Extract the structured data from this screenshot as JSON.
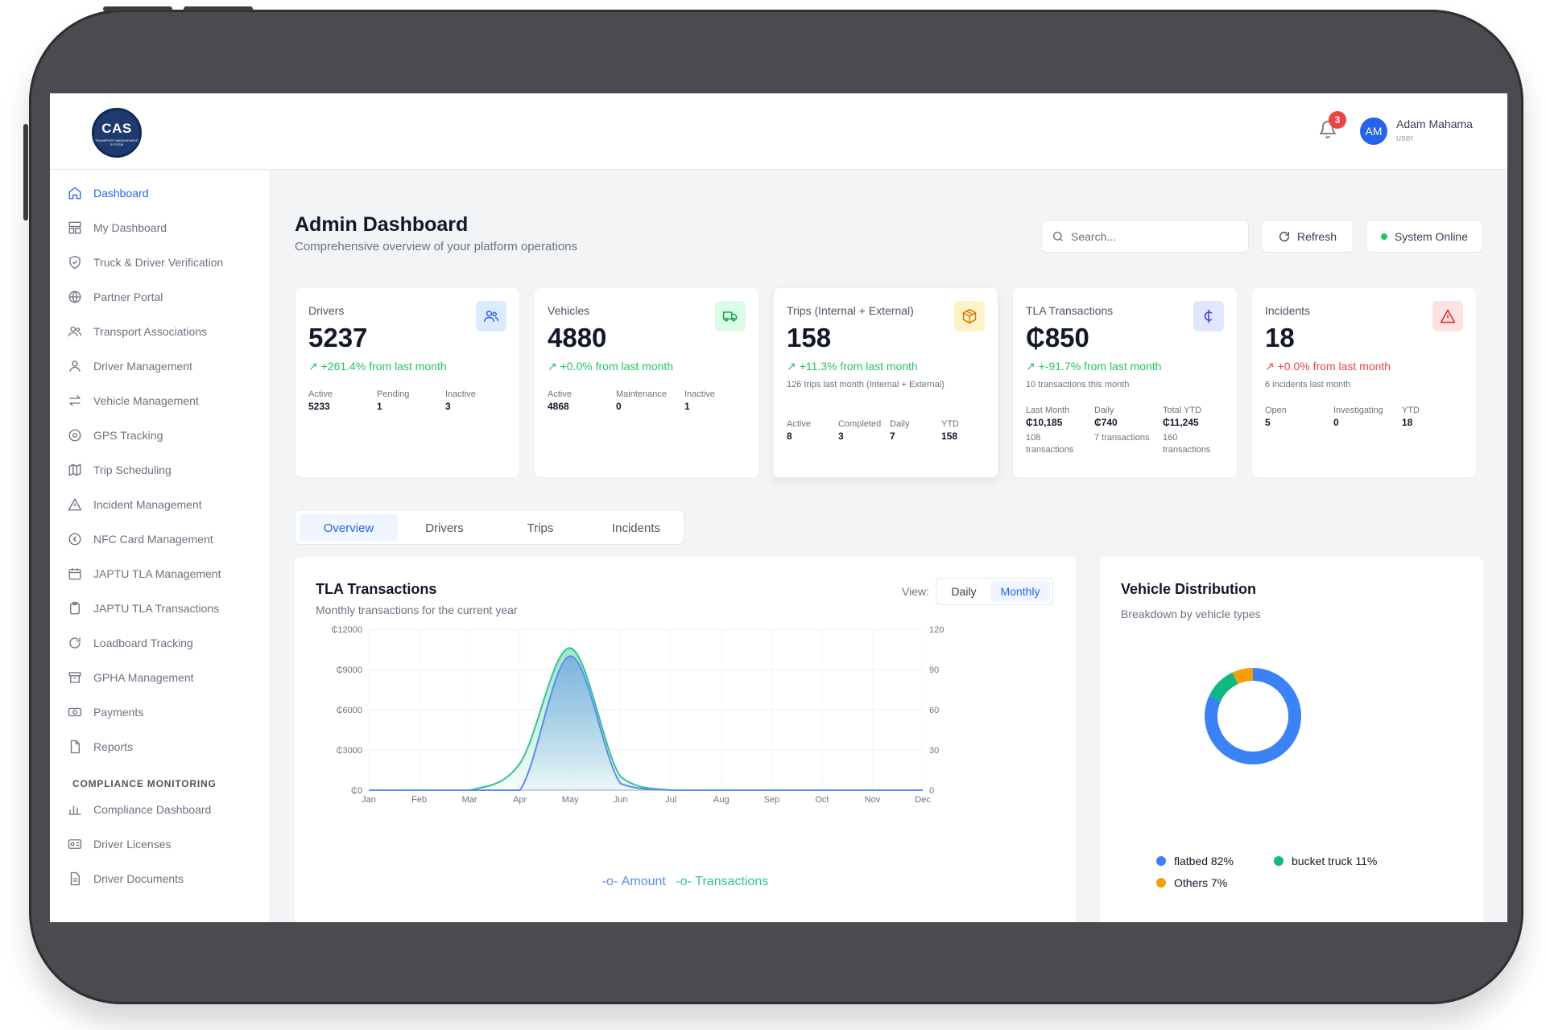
{
  "app": {
    "logo_text": "CAS",
    "logo_subtitle": "Transport Management System"
  },
  "topbar": {
    "notification_count": "3",
    "user_initials": "AM",
    "user_name": "Adam Mahama",
    "user_role": "user"
  },
  "sidebar": {
    "items": [
      {
        "label": "Dashboard",
        "icon": "home-icon"
      },
      {
        "label": "My Dashboard",
        "icon": "layout-icon"
      },
      {
        "label": "Truck & Driver Verification",
        "icon": "shield-check-icon"
      },
      {
        "label": "Partner Portal",
        "icon": "globe-icon"
      },
      {
        "label": "Transport Associations",
        "icon": "users-icon"
      },
      {
        "label": "Driver Management",
        "icon": "user-icon"
      },
      {
        "label": "Vehicle Management",
        "icon": "arrows-icon"
      },
      {
        "label": "GPS Tracking",
        "icon": "map-pin-icon"
      },
      {
        "label": "Trip Scheduling",
        "icon": "map-icon"
      },
      {
        "label": "Incident Management",
        "icon": "alert-triangle-icon"
      },
      {
        "label": "NFC Card Management",
        "icon": "coin-icon"
      },
      {
        "label": "JAPTU TLA Management",
        "icon": "calendar-icon"
      },
      {
        "label": "JAPTU TLA Transactions",
        "icon": "clipboard-icon"
      },
      {
        "label": "Loadboard Tracking",
        "icon": "refresh-icon"
      },
      {
        "label": "GPHA Management",
        "icon": "archive-icon"
      },
      {
        "label": "Payments",
        "icon": "banknote-icon"
      },
      {
        "label": "Reports",
        "icon": "file-icon"
      }
    ],
    "section_title": "COMPLIANCE MONITORING",
    "compliance_items": [
      {
        "label": "Compliance Dashboard",
        "icon": "bar-chart-icon"
      },
      {
        "label": "Driver Licenses",
        "icon": "id-card-icon"
      },
      {
        "label": "Driver Documents",
        "icon": "document-icon"
      }
    ]
  },
  "header": {
    "title": "Admin Dashboard",
    "subtitle": "Comprehensive overview of your platform operations",
    "search_placeholder": "Search...",
    "refresh_label": "Refresh",
    "status_label": "System Online"
  },
  "cards": {
    "drivers": {
      "title": "Drivers",
      "value": "5237",
      "change": "+261.4% from last month",
      "stats": [
        {
          "label": "Active",
          "value": "5233"
        },
        {
          "label": "Pending",
          "value": "1"
        },
        {
          "label": "Inactive",
          "value": "3"
        }
      ]
    },
    "vehicles": {
      "title": "Vehicles",
      "value": "4880",
      "change": "+0.0% from last month",
      "stats": [
        {
          "label": "Active",
          "value": "4868"
        },
        {
          "label": "Maintenance",
          "value": "0"
        },
        {
          "label": "Inactive",
          "value": "1"
        }
      ]
    },
    "trips": {
      "title": "Trips (Internal + External)",
      "value": "158",
      "change": "+11.3% from last month",
      "note": "126 trips last month (Internal + External)",
      "stats": [
        {
          "label": "Active",
          "value": "8"
        },
        {
          "label": "Completed",
          "value": "3"
        },
        {
          "label": "Daily",
          "value": "7"
        },
        {
          "label": "YTD",
          "value": "158"
        }
      ]
    },
    "tla": {
      "title": "TLA Transactions",
      "value": "₵850",
      "change": "+-91.7% from last month",
      "note": "10 transactions this month",
      "stats": [
        {
          "label": "Last Month",
          "value": "₵10,185",
          "sub": "108 transactions"
        },
        {
          "label": "Daily",
          "value": "₵740",
          "sub": "7 transactions"
        },
        {
          "label": "Total YTD",
          "value": "₵11,245",
          "sub": "160 transactions"
        }
      ]
    },
    "incidents": {
      "title": "Incidents",
      "value": "18",
      "change": "+0.0% from last month",
      "note": "6 incidents last month",
      "stats": [
        {
          "label": "Open",
          "value": "5"
        },
        {
          "label": "Investigating",
          "value": "0"
        },
        {
          "label": "YTD",
          "value": "18"
        }
      ]
    }
  },
  "colors": {
    "primary": "#2563eb",
    "positive": "#22c55e",
    "negative": "#ef4444",
    "amount_line": "#5b8def",
    "transactions_line": "#34c38f",
    "flatbed": "#3b82f6",
    "bucket_truck": "#10b981",
    "others": "#f59e0b"
  },
  "tabs": [
    "Overview",
    "Drivers",
    "Trips",
    "Incidents"
  ],
  "tla_chart": {
    "title": "TLA Transactions",
    "subtitle": "Monthly transactions for the current year",
    "view_label": "View:",
    "view_options": [
      "Daily",
      "Monthly"
    ],
    "selected_view": "Monthly"
  },
  "vehicle_distribution": {
    "title": "Vehicle Distribution",
    "subtitle": "Breakdown by vehicle types"
  },
  "chart_data": [
    {
      "type": "area",
      "x": [
        "Jan",
        "Feb",
        "Mar",
        "Apr",
        "May",
        "Jun",
        "Jul",
        "Aug",
        "Sep",
        "Oct",
        "Nov",
        "Dec"
      ],
      "series": [
        {
          "name": "Amount",
          "axis": "left",
          "values": [
            0,
            0,
            0,
            0,
            10000,
            500,
            0,
            0,
            0,
            0,
            0,
            0
          ]
        },
        {
          "name": "Transactions",
          "axis": "right",
          "values": [
            0,
            0,
            0,
            20,
            106,
            10,
            0,
            0,
            0,
            0,
            0,
            0
          ]
        }
      ],
      "y_left_ticks": [
        "₵0",
        "₵3000",
        "₵6000",
        "₵9000",
        "₵12000"
      ],
      "y_right_ticks": [
        "0",
        "30",
        "60",
        "90",
        "120"
      ],
      "ylim_left": [
        0,
        12000
      ],
      "ylim_right": [
        0,
        120
      ],
      "legend": "bottom"
    },
    {
      "type": "pie",
      "donut": true,
      "labels": [
        "flatbed",
        "bucket truck",
        "Others"
      ],
      "values": [
        82,
        11,
        7
      ],
      "legend_labels": [
        "flatbed 82%",
        "bucket truck 11%",
        "Others 7%"
      ]
    }
  ]
}
